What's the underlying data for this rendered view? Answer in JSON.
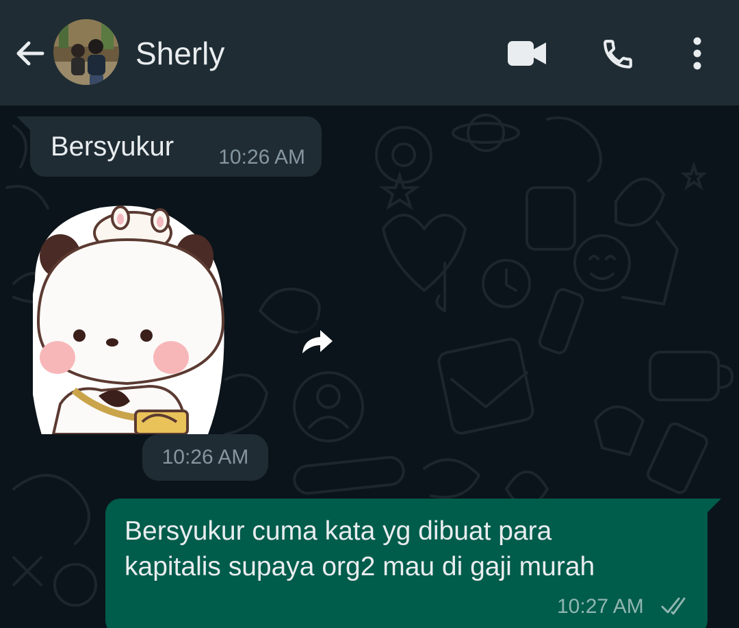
{
  "header": {
    "contact_name": "Sherly",
    "icons": [
      "back-arrow-icon",
      "avatar",
      "video-call-icon",
      "voice-call-icon",
      "more-options-icon"
    ],
    "background": "#1f2c34"
  },
  "chat": {
    "background": "#0b141a",
    "messages": [
      {
        "direction": "incoming",
        "type": "text",
        "text": "Bersyukur",
        "time": "10:26 AM"
      },
      {
        "direction": "incoming",
        "type": "sticker",
        "sticker": "cute white bear with bunny hat",
        "time": "10:26 AM"
      },
      {
        "direction": "outgoing",
        "type": "text",
        "text_lines": [
          "Bersyukur cuma kata yg dibuat para",
          "kapitalis supaya org2 mau di gaji murah"
        ],
        "time": "10:27 AM",
        "status": "read-double-check"
      }
    ]
  },
  "colors": {
    "incoming_bubble": "#1f2c34",
    "outgoing_bubble": "#005c4b",
    "text": "#e9edef",
    "meta": "#8696a0"
  }
}
